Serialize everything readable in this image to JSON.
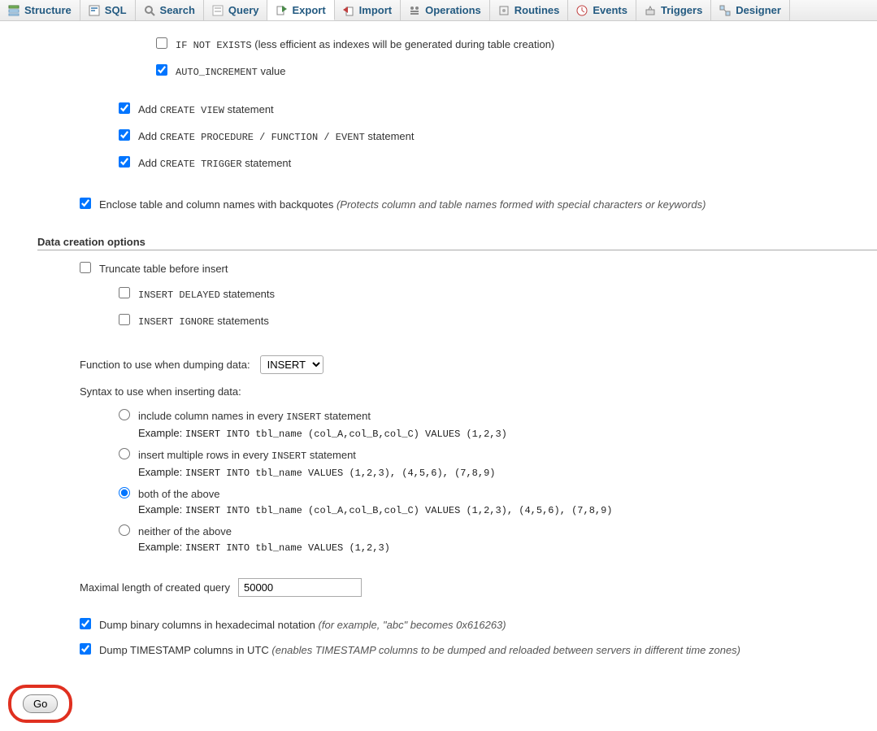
{
  "tabs": [
    {
      "label": "Structure",
      "icon": "structure"
    },
    {
      "label": "SQL",
      "icon": "sql"
    },
    {
      "label": "Search",
      "icon": "search"
    },
    {
      "label": "Query",
      "icon": "query"
    },
    {
      "label": "Export",
      "icon": "export",
      "active": true
    },
    {
      "label": "Import",
      "icon": "import"
    },
    {
      "label": "Operations",
      "icon": "operations"
    },
    {
      "label": "Routines",
      "icon": "routines"
    },
    {
      "label": "Events",
      "icon": "events"
    },
    {
      "label": "Triggers",
      "icon": "triggers"
    },
    {
      "label": "Designer",
      "icon": "designer"
    }
  ],
  "opts": {
    "ifNotExists": {
      "code": "IF NOT EXISTS",
      "desc": " (less efficient as indexes will be generated during table creation)"
    },
    "autoInc": {
      "code": "AUTO_INCREMENT",
      "desc": " value"
    },
    "createView": {
      "pre": "Add ",
      "code": "CREATE VIEW",
      "post": " statement"
    },
    "createProc": {
      "pre": "Add ",
      "code": "CREATE PROCEDURE / FUNCTION / EVENT",
      "post": " statement"
    },
    "createTrig": {
      "pre": "Add ",
      "code": "CREATE TRIGGER",
      "post": " statement"
    },
    "backquotes": {
      "text": "Enclose table and column names with backquotes ",
      "italic": "(Protects column and table names formed with special characters or keywords)"
    }
  },
  "dataSection": {
    "header": "Data creation options",
    "truncate": "Truncate table before insert",
    "insDelayed": {
      "code": "INSERT DELAYED",
      "post": " statements"
    },
    "insIgnore": {
      "code": "INSERT IGNORE",
      "post": " statements"
    },
    "funcLabel": "Function to use when dumping data:",
    "funcValue": "INSERT",
    "syntaxLabel": "Syntax to use when inserting data:",
    "radios": [
      {
        "label_pre": "include column names in every ",
        "label_code": "INSERT",
        "label_post": " statement",
        "ex": "INSERT INTO tbl_name (col_A,col_B,col_C) VALUES (1,2,3)"
      },
      {
        "label_pre": "insert multiple rows in every ",
        "label_code": "INSERT",
        "label_post": " statement",
        "ex": "INSERT INTO tbl_name VALUES (1,2,3), (4,5,6), (7,8,9)"
      },
      {
        "label_pre": "both of the above",
        "label_code": "",
        "label_post": "",
        "ex": "INSERT INTO tbl_name (col_A,col_B,col_C) VALUES (1,2,3), (4,5,6), (7,8,9)"
      },
      {
        "label_pre": "neither of the above",
        "label_code": "",
        "label_post": "",
        "ex": "INSERT INTO tbl_name VALUES (1,2,3)"
      }
    ],
    "exampleWord": "Example: ",
    "maxLenLabel": "Maximal length of created query",
    "maxLenValue": "50000",
    "dumpHex": {
      "text": "Dump binary columns in hexadecimal notation ",
      "italic": "(for example, \"abc\" becomes 0x616263)"
    },
    "dumpUtc": {
      "text": "Dump TIMESTAMP columns in UTC ",
      "italic": "(enables TIMESTAMP columns to be dumped and reloaded between servers in different time zones)"
    }
  },
  "goLabel": "Go"
}
